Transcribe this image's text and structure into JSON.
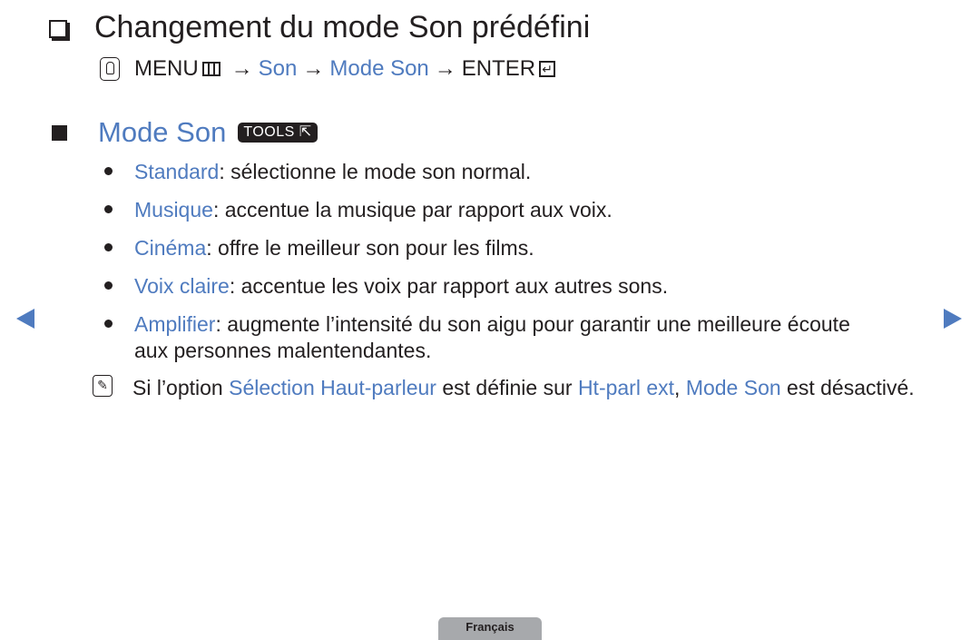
{
  "title": "Changement du mode Son prédéfini",
  "path": {
    "menu": "MENU",
    "arrow": "→",
    "son": "Son",
    "mode_son": "Mode Son",
    "enter": "ENTER",
    "enter_glyph": "↵"
  },
  "section": {
    "title": "Mode Son",
    "tools_label": "TOOLS"
  },
  "items": [
    {
      "term": "Standard",
      "desc": ": sélectionne le mode son normal."
    },
    {
      "term": "Musique",
      "desc": ": accentue la musique par rapport aux voix."
    },
    {
      "term": "Cinéma",
      "desc": ": offre le meilleur son pour les films."
    },
    {
      "term": "Voix claire",
      "desc": ": accentue les voix par rapport aux autres sons."
    },
    {
      "term": "Amplifier",
      "desc": ": augmente l’intensité du son aigu pour garantir une meilleure écoute",
      "cont": "aux personnes malentendantes."
    }
  ],
  "note": {
    "p1": "Si l’option ",
    "t1": "Sélection Haut-parleur",
    "p2": " est définie sur ",
    "t2": "Ht-parl ext",
    "p3": ", ",
    "t3": "Mode Son",
    "p4": " est désactivé."
  },
  "language": "Français",
  "colors": {
    "accent": "#4f7bbf",
    "text": "#231f20",
    "lang_tab": "#a7a9ac"
  }
}
